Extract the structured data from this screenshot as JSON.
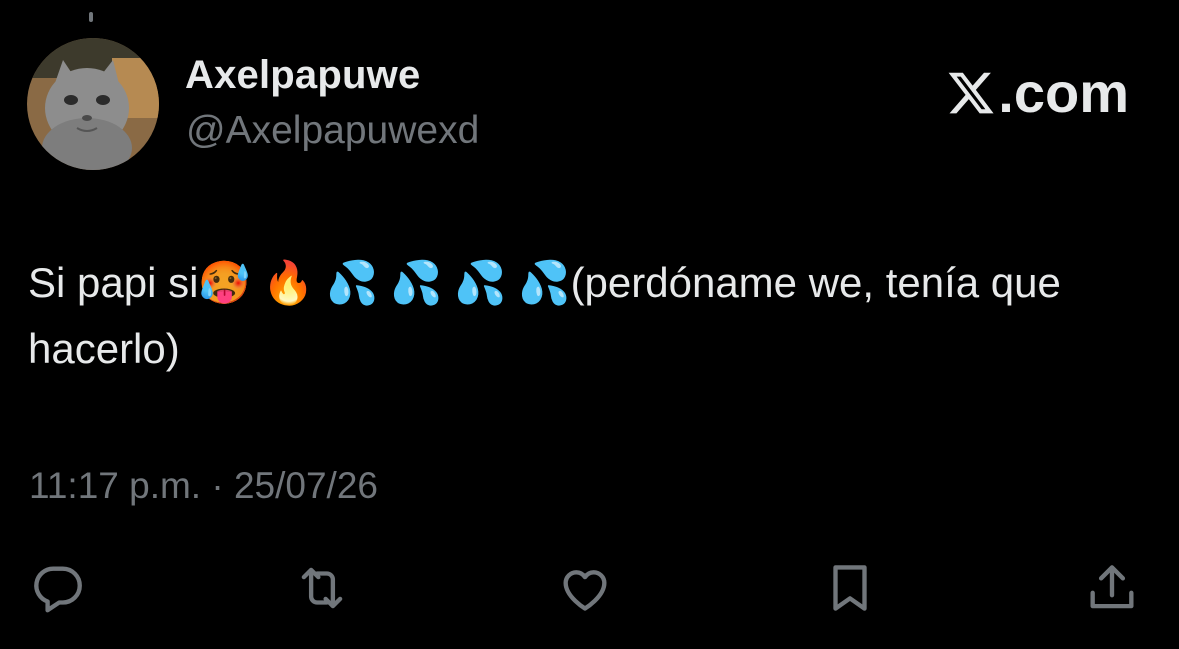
{
  "tweet": {
    "display_name": "Axelpapuwe",
    "handle": "@Axelpapuwexd",
    "brand": ".com",
    "text_start": "Si papi si",
    "emojis": [
      "🥵",
      "🔥",
      "💦",
      "💦",
      "💦",
      "💦"
    ],
    "text_end": "(perdóname we, tenía que hacerlo)",
    "timestamp": "11:17 p.m. · 25/07/26"
  },
  "icons": {
    "reply": "reply-icon",
    "retweet": "retweet-icon",
    "like": "heart-icon",
    "bookmark": "bookmark-icon",
    "share": "share-icon"
  },
  "colors": {
    "background": "#000000",
    "text": "#e7e9ea",
    "secondary": "#71767b"
  }
}
